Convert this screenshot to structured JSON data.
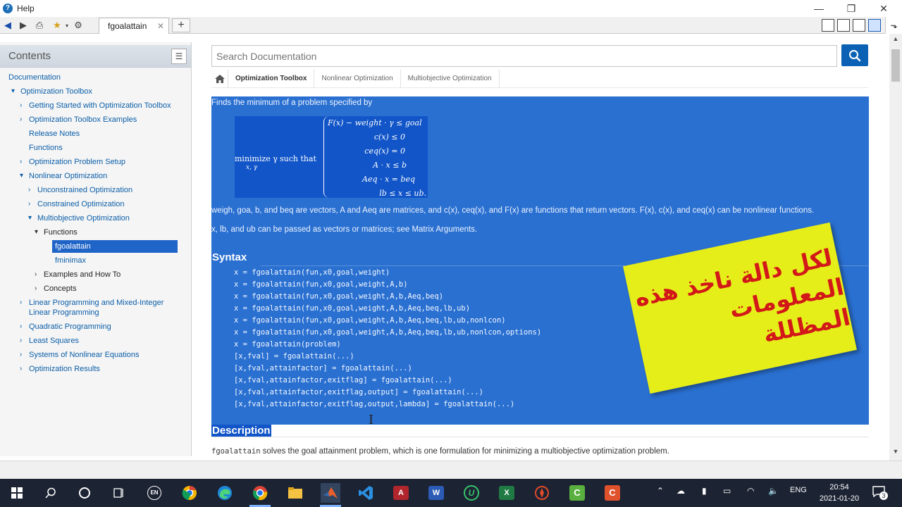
{
  "window": {
    "title": "Help"
  },
  "tab": {
    "label": "fgoalattain",
    "close": "✕",
    "new": "+"
  },
  "sidebar": {
    "heading": "Contents",
    "items": [
      {
        "label": "Documentation"
      },
      {
        "label": "Optimization Toolbox",
        "arrow": "▾"
      },
      {
        "label": "Getting Started with Optimization Toolbox",
        "arrow": "›"
      },
      {
        "label": "Optimization Toolbox Examples",
        "arrow": "›"
      },
      {
        "label": "Release Notes"
      },
      {
        "label": "Functions"
      },
      {
        "label": "Optimization Problem Setup",
        "arrow": "›"
      },
      {
        "label": "Nonlinear Optimization",
        "arrow": "▾"
      },
      {
        "label": "Unconstrained Optimization",
        "arrow": "›"
      },
      {
        "label": "Constrained Optimization",
        "arrow": "›"
      },
      {
        "label": "Multiobjective Optimization",
        "arrow": "▾"
      },
      {
        "label": "Functions",
        "arrow": "▾"
      },
      {
        "label": "fgoalattain"
      },
      {
        "label": "fminimax"
      },
      {
        "label": "Examples and How To",
        "arrow": "›"
      },
      {
        "label": "Concepts",
        "arrow": "›"
      },
      {
        "label": "Linear Programming and Mixed-Integer",
        "label2": "Linear Programming",
        "arrow": "›"
      },
      {
        "label": "Quadratic Programming",
        "arrow": "›"
      },
      {
        "label": "Least Squares",
        "arrow": "›"
      },
      {
        "label": "Systems of Nonlinear Equations",
        "arrow": "›"
      },
      {
        "label": "Optimization Results",
        "arrow": "›"
      }
    ]
  },
  "search": {
    "placeholder": "Search Documentation"
  },
  "breadcrumb": [
    "Optimization Toolbox",
    "Nonlinear Optimization",
    "Multiobjective Optimization"
  ],
  "doc": {
    "intro": "Finds the minimum of a problem specified by",
    "formula": {
      "minimize": "minimize γ",
      "minimize_sub": "x, γ",
      "such_that": "such that",
      "conditions": [
        "F(x) − weight · γ ≤ goal",
        "c(x) ≤ 0",
        "ceq(x) = 0",
        "A · x ≤ b",
        "Aeq · x = beq",
        "lb ≤ x ≤ ub."
      ]
    },
    "para1": "weigh, goa, b, and beq are vectors, A and Aeq are matrices, and c(x), ceq(x), and F(x) are functions that return vectors. F(x), c(x), and ceq(x) can be nonlinear functions.",
    "para2": "x, lb, and ub can be passed as vectors or matrices; see Matrix Arguments.",
    "syntax_title": "Syntax",
    "syntax": [
      "x = fgoalattain(fun,x0,goal,weight)",
      "x = fgoalattain(fun,x0,goal,weight,A,b)",
      "x = fgoalattain(fun,x0,goal,weight,A,b,Aeq,beq)",
      "x = fgoalattain(fun,x0,goal,weight,A,b,Aeq,beq,lb,ub)",
      "x = fgoalattain(fun,x0,goal,weight,A,b,Aeq,beq,lb,ub,nonlcon)",
      "x = fgoalattain(fun,x0,goal,weight,A,b,Aeq,beq,lb,ub,nonlcon,options)",
      "x = fgoalattain(problem)",
      "[x,fval] = fgoalattain(...)",
      "[x,fval,attainfactor] = fgoalattain(...)",
      "[x,fval,attainfactor,exitflag] = fgoalattain(...)",
      "[x,fval,attainfactor,exitflag,output] = fgoalattain(...)",
      "[x,fval,attainfactor,exitflag,output,lambda] = fgoalattain(...)"
    ],
    "description_title": "Description",
    "description_code": "fgoalattain",
    "description_text": " solves the goal attainment problem, which is one formulation for minimizing a multiobjective optimization problem."
  },
  "sticker": {
    "line1": "لكل دالة ناخذ هذه",
    "line2": "المعلومات المظللة",
    "color": "#e6ee19",
    "text_color": "#d21818"
  },
  "taskbar": {
    "clock_time": "20:54",
    "clock_date": "2021-01-20",
    "lang": "ENG",
    "notif_count": "3",
    "en_badge": "EN"
  },
  "colors": {
    "accent": "#0b62b5",
    "selection": "#2a70d1",
    "link": "#0b5ea8"
  }
}
